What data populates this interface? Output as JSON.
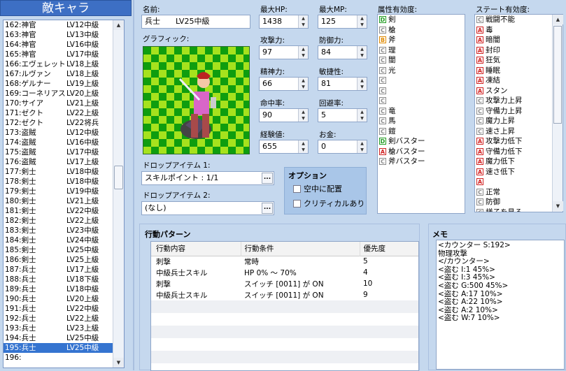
{
  "left": {
    "title": "敵キャラ",
    "items": [
      [
        "162:神官",
        "LV12中級"
      ],
      [
        "163:神官",
        "LV13中級"
      ],
      [
        "164:神官",
        "LV16中級"
      ],
      [
        "165:神官",
        "LV17中級"
      ],
      [
        "166:エヴェレット",
        "LV18上級"
      ],
      [
        "167:ルヴァン",
        "LV18上級"
      ],
      [
        "168:ゲルナー",
        "LV19上級"
      ],
      [
        "169:コーネリアス",
        "LV20上級"
      ],
      [
        "170:サイア",
        "LV21上級"
      ],
      [
        "171:ゼクト",
        "LV22上級"
      ],
      [
        "172:ゼクト",
        "LV22将兵"
      ],
      [
        "173:盗賊",
        "LV12中級"
      ],
      [
        "174:盗賊",
        "LV16中級"
      ],
      [
        "175:盗賊",
        "LV17中級"
      ],
      [
        "176:盗賊",
        "LV17上級"
      ],
      [
        "177:剣士",
        "LV18中級"
      ],
      [
        "178:剣士",
        "LV18中級"
      ],
      [
        "179:剣士",
        "LV19中級"
      ],
      [
        "180:剣士",
        "LV21上級"
      ],
      [
        "181:剣士",
        "LV22中級"
      ],
      [
        "182:剣士",
        "LV22上級"
      ],
      [
        "183:剣士",
        "LV23中級"
      ],
      [
        "184:剣士",
        "LV24中級"
      ],
      [
        "185:剣士",
        "LV25中級"
      ],
      [
        "186:剣士",
        "LV25上級"
      ],
      [
        "187:兵士",
        "LV17上級"
      ],
      [
        "188:兵士",
        "LV18下級"
      ],
      [
        "189:兵士",
        "LV18中級"
      ],
      [
        "190:兵士",
        "LV20上級"
      ],
      [
        "191:兵士",
        "LV22中級"
      ],
      [
        "192:兵士",
        "LV22上級"
      ],
      [
        "193:兵士",
        "LV23上級"
      ],
      [
        "194:兵士",
        "LV25中級"
      ],
      [
        "195:兵士",
        "LV25中級"
      ],
      [
        "196:",
        ""
      ]
    ],
    "selected_index": 33
  },
  "form": {
    "name_label": "名前:",
    "name_value": "兵士　　LV25中級",
    "graphic_label": "グラフィック:",
    "maxhp_label": "最大HP:",
    "maxhp": "1438",
    "maxmp_label": "最大MP:",
    "maxmp": "125",
    "atk_label": "攻撃力:",
    "atk": "97",
    "def_label": "防御力:",
    "def": "84",
    "spi_label": "精神力:",
    "spi": "66",
    "agi_label": "敏捷性:",
    "agi": "81",
    "hit_label": "命中率:",
    "hit": "90",
    "eva_label": "回避率:",
    "eva": "5",
    "exp_label": "経験値:",
    "exp": "655",
    "gold_label": "お金:",
    "gold": "0",
    "drop1_label": "ドロップアイテム 1:",
    "drop1": "スキルポイント : 1/1",
    "drop2_label": "ドロップアイテム 2:",
    "drop2": "(なし)",
    "ellipsis": "...",
    "options_title": "オプション",
    "opt_air": "空中に配置",
    "opt_crit": "クリティカルあり"
  },
  "elements": {
    "title": "属性有効度:",
    "rows": [
      {
        "b": "D",
        "t": "剣"
      },
      {
        "b": "C",
        "t": "槍"
      },
      {
        "b": "B",
        "t": "斧"
      },
      {
        "b": "C",
        "t": "理"
      },
      {
        "b": "C",
        "t": "闇"
      },
      {
        "b": "C",
        "t": "光"
      },
      {
        "b": "C",
        "t": ""
      },
      {
        "b": "C",
        "t": ""
      },
      {
        "b": "C",
        "t": ""
      },
      {
        "b": "C",
        "t": "竜"
      },
      {
        "b": "C",
        "t": "馬"
      },
      {
        "b": "C",
        "t": "鎧"
      },
      {
        "b": "D",
        "t": "剣バスター"
      },
      {
        "b": "A",
        "t": "槍バスター"
      },
      {
        "b": "C",
        "t": "斧バスター"
      }
    ]
  },
  "states": {
    "title": "ステート有効度:",
    "rows": [
      {
        "b": "C",
        "t": "戦闘不能"
      },
      {
        "b": "A",
        "t": "毒"
      },
      {
        "b": "A",
        "t": "暗闇"
      },
      {
        "b": "A",
        "t": "封印"
      },
      {
        "b": "A",
        "t": "狂気"
      },
      {
        "b": "A",
        "t": "睡眠"
      },
      {
        "b": "A",
        "t": "凍結"
      },
      {
        "b": "A",
        "t": "スタン"
      },
      {
        "b": "C",
        "t": "攻撃力上昇"
      },
      {
        "b": "C",
        "t": "守備力上昇"
      },
      {
        "b": "C",
        "t": "魔力上昇"
      },
      {
        "b": "C",
        "t": "速さ上昇"
      },
      {
        "b": "A",
        "t": "攻撃力低下"
      },
      {
        "b": "A",
        "t": "守備力低下"
      },
      {
        "b": "A",
        "t": "魔力低下"
      },
      {
        "b": "A",
        "t": "速さ低下"
      },
      {
        "b": "A",
        "t": ""
      },
      {
        "b": "C",
        "t": "正常"
      },
      {
        "b": "C",
        "t": "防御"
      },
      {
        "b": "C",
        "t": "様子を見る"
      }
    ]
  },
  "actions": {
    "title": "行動パターン",
    "headers": [
      "行動内容",
      "行動条件",
      "優先度"
    ],
    "rows": [
      [
        "刺撃",
        "常時",
        "5"
      ],
      [
        "中級兵士スキル",
        "HP 0% ～ 70%",
        "4"
      ],
      [
        "刺撃",
        "スイッチ [0011] が ON",
        "10"
      ],
      [
        "中級兵士スキル",
        "スイッチ [0011] が ON",
        "9"
      ]
    ]
  },
  "memo": {
    "title": "メモ",
    "lines": [
      "<カウンター S:192>",
      "物理攻撃",
      "</カウンター>",
      "<盗む I:1 45%>",
      "<盗む I:3 45%>",
      "<盗む G:500 45%>",
      "<盗む A:17 10%>",
      "<盗む A:22 10%>",
      "<盗む A:2 10%>",
      "<盗む W:7 10%>"
    ]
  },
  "colors": {
    "A": "#d02020",
    "B": "#e08a00",
    "C": "#8a8a8a",
    "D": "#1e9a1e",
    "selected": "#3574d0"
  }
}
